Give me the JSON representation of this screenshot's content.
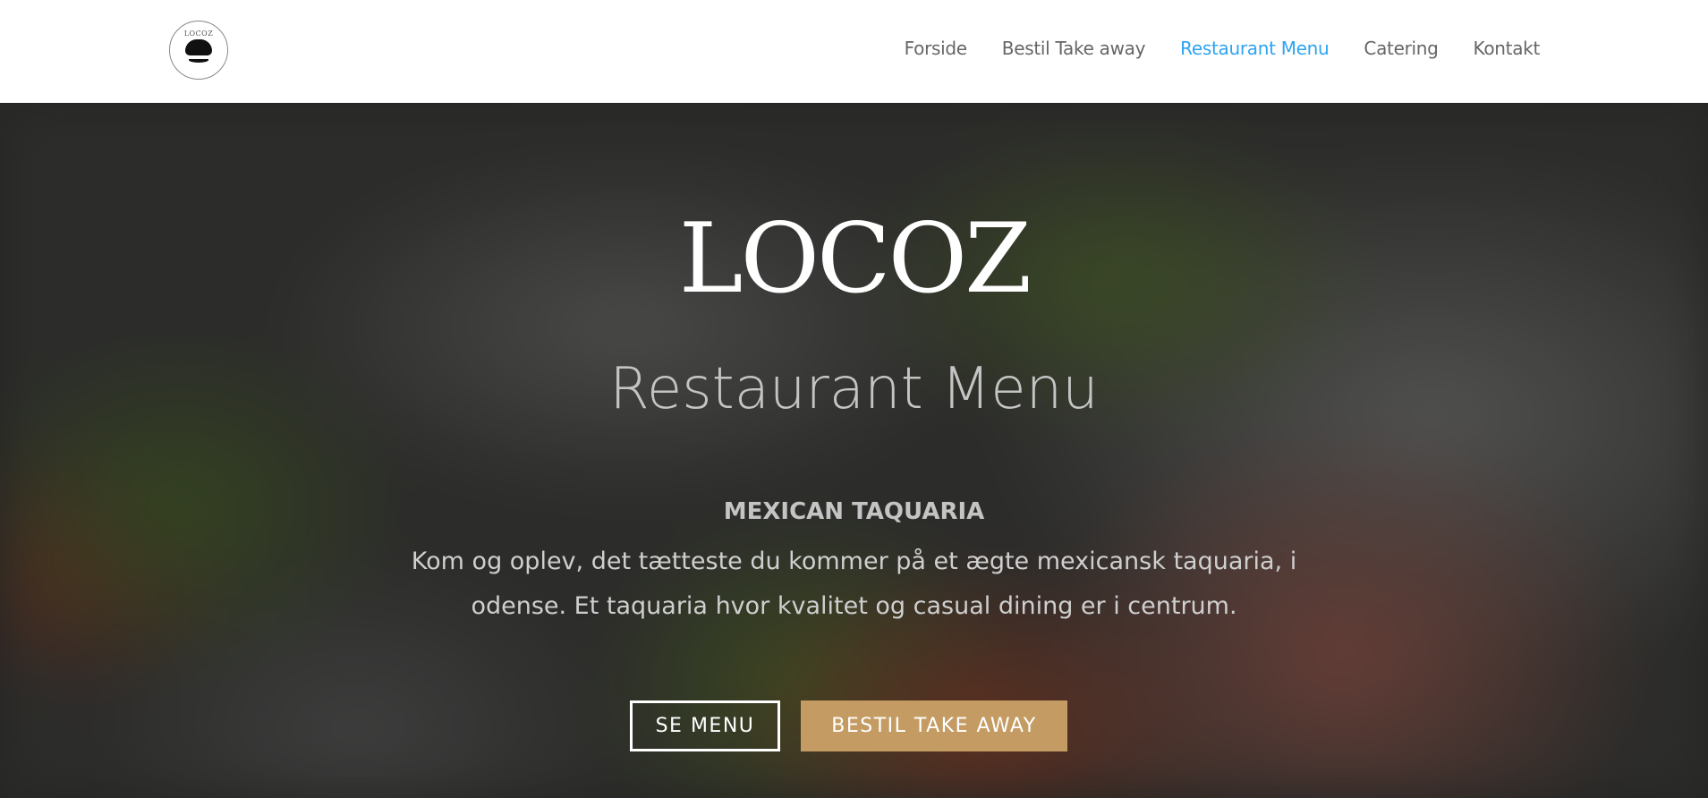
{
  "logo": {
    "text": "LOCOZ"
  },
  "nav": [
    {
      "label": "Forside"
    },
    {
      "label": "Bestil Take away"
    },
    {
      "label": "Restaurant Menu",
      "active": true
    },
    {
      "label": "Catering"
    },
    {
      "label": "Kontakt"
    }
  ],
  "hero": {
    "title": "LOCOZ",
    "subtitle": "Restaurant Menu",
    "tagline": "MEXICAN TAQUARIA",
    "description": "Kom og oplev, det tætteste du kommer på et ægte mexicansk taquaria, i odense. Et taquaria hvor kvalitet og casual dining er i centrum.",
    "buttons": {
      "primary": "SE MENU",
      "secondary": "BESTIL TAKE AWAY"
    }
  },
  "colors": {
    "accent": "#2ea3f2",
    "button": "#c49c63"
  }
}
